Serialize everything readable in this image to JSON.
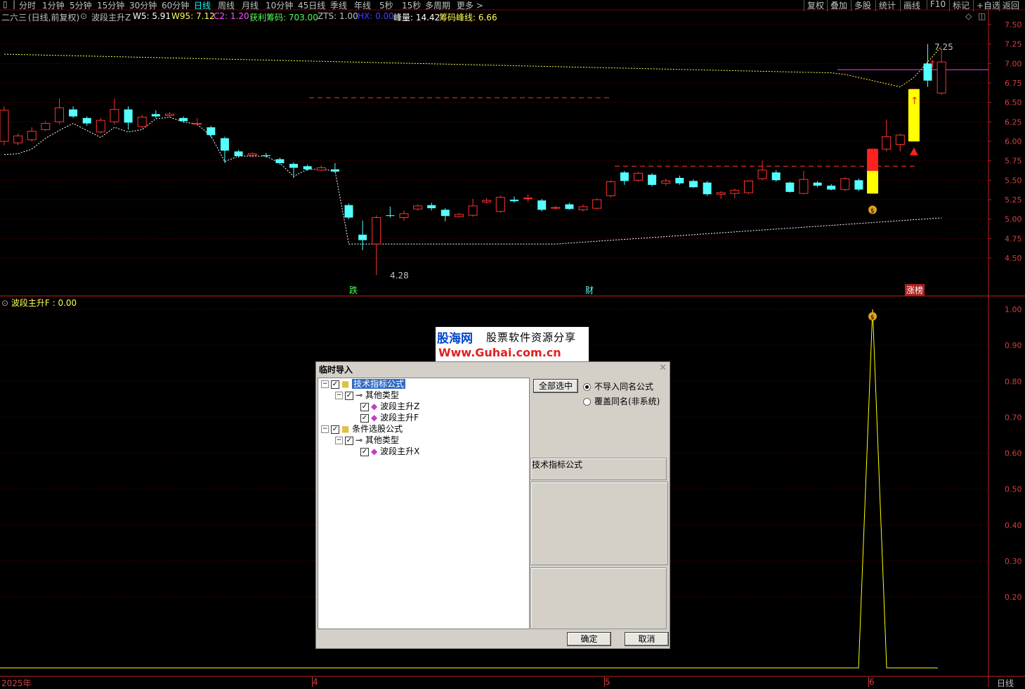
{
  "toolbar": {
    "tabs": [
      "分时",
      "1分钟",
      "5分钟",
      "15分钟",
      "30分钟",
      "60分钟",
      "日线",
      "周线",
      "月线",
      "10分钟",
      "45日线",
      "季线",
      "年线",
      "5秒",
      "15秒",
      "多周期",
      "更多 >"
    ],
    "active_tab": "日线",
    "right_buttons": [
      "复权",
      "叠加",
      "多股",
      "统计",
      "画线",
      "F10",
      "标记",
      "+自选",
      "返回"
    ]
  },
  "info": {
    "stock": "二六三",
    "period": "(日线,前复权)",
    "indicator": "波段主升Z",
    "w5": "W5: 5.91",
    "w95": "W95: 7.12",
    "c2": "C2: 1.20",
    "profit_chips": "获利筹码: 703.00",
    "zts": "ZTS: 1.00",
    "hx": "HX: 0.00",
    "peak": "峰量: 14.42",
    "chip_peak": "筹码峰线: 6.66"
  },
  "colors": {
    "up": "#ff3232",
    "down": "#54ffff",
    "grid": "#800000",
    "axis": "#d04040"
  },
  "price_axis": [
    "7.50",
    "7.25",
    "7.00",
    "6.75",
    "6.50",
    "6.25",
    "6.00",
    "5.75",
    "5.50",
    "5.25",
    "5.00",
    "4.75",
    "4.50"
  ],
  "annotations": {
    "low": "4.28",
    "high": "7.25",
    "tag_die": "跌",
    "tag_cai": "财",
    "tag_zt": "涨榜"
  },
  "sub": {
    "title": "波段主升F : 0.00",
    "axis": [
      "1.00",
      "0.90",
      "0.80",
      "0.70",
      "0.60",
      "0.50",
      "0.40",
      "0.30",
      "0.20"
    ]
  },
  "bottom": {
    "dates": [
      "2025年",
      "4",
      "5",
      "6"
    ],
    "period_label": "日线"
  },
  "banner": {
    "line1": "股海网",
    "line1b": "股票软件资源分享",
    "line2": "Www.Guhai.com.cn"
  },
  "dialog": {
    "title": "临时导入",
    "close": "✕",
    "tree": {
      "root1": "技术指标公式",
      "cat1": "其他类型",
      "item1": "波段主升Z",
      "item2": "波段主升F",
      "root2": "条件选股公式",
      "cat2": "其他类型",
      "item3": "波段主升X"
    },
    "select_all": "全部选中",
    "opt1": "不导入同名公式",
    "opt2": "覆盖同名(非系统)",
    "info_label": "技术指标公式",
    "ok": "确定",
    "cancel": "取消"
  },
  "chart_data": {
    "type": "candlestick",
    "candles": [
      {
        "o": 6.0,
        "c": 6.4,
        "h": 6.45,
        "l": 5.95
      },
      {
        "o": 5.98,
        "c": 6.07,
        "h": 6.1,
        "l": 5.95
      },
      {
        "o": 6.02,
        "c": 6.13,
        "h": 6.18,
        "l": 6.0
      },
      {
        "o": 6.15,
        "c": 6.23,
        "h": 6.26,
        "l": 6.13
      },
      {
        "o": 6.25,
        "c": 6.43,
        "h": 6.55,
        "l": 6.22
      },
      {
        "o": 6.41,
        "c": 6.32,
        "h": 6.45,
        "l": 6.3
      },
      {
        "o": 6.3,
        "c": 6.23,
        "h": 6.32,
        "l": 6.2
      },
      {
        "o": 6.12,
        "c": 6.27,
        "h": 6.3,
        "l": 6.1
      },
      {
        "o": 6.25,
        "c": 6.41,
        "h": 6.55,
        "l": 6.22
      },
      {
        "o": 6.41,
        "c": 6.24,
        "h": 6.45,
        "l": 6.15
      },
      {
        "o": 6.19,
        "c": 6.31,
        "h": 6.34,
        "l": 6.17
      },
      {
        "o": 6.35,
        "c": 6.32,
        "h": 6.4,
        "l": 6.3
      },
      {
        "o": 6.33,
        "c": 6.35,
        "h": 6.38,
        "l": 6.31
      },
      {
        "o": 6.3,
        "c": 6.26,
        "h": 6.32,
        "l": 6.24
      },
      {
        "o": 6.22,
        "c": 6.23,
        "h": 6.3,
        "l": 6.2
      },
      {
        "o": 6.18,
        "c": 6.08,
        "h": 6.2,
        "l": 6.05
      },
      {
        "o": 6.04,
        "c": 5.88,
        "h": 6.06,
        "l": 5.72
      },
      {
        "o": 5.87,
        "c": 5.81,
        "h": 5.89,
        "l": 5.79
      },
      {
        "o": 5.82,
        "c": 5.84,
        "h": 5.86,
        "l": 5.79
      },
      {
        "o": 5.82,
        "c": 5.81,
        "h": 5.85,
        "l": 5.79
      },
      {
        "o": 5.77,
        "c": 5.72,
        "h": 5.79,
        "l": 5.7
      },
      {
        "o": 5.71,
        "c": 5.66,
        "h": 5.73,
        "l": 5.53
      },
      {
        "o": 5.68,
        "c": 5.64,
        "h": 5.7,
        "l": 5.62
      },
      {
        "o": 5.63,
        "c": 5.66,
        "h": 5.69,
        "l": 5.62
      },
      {
        "o": 5.64,
        "c": 5.61,
        "h": 5.72,
        "l": 5.6
      },
      {
        "o": 5.18,
        "c": 5.02,
        "h": 5.2,
        "l": 5.0
      },
      {
        "o": 4.8,
        "c": 4.73,
        "h": 4.98,
        "l": 4.6
      },
      {
        "o": 4.68,
        "c": 5.02,
        "h": 5.05,
        "l": 4.28
      },
      {
        "o": 5.05,
        "c": 5.04,
        "h": 5.16,
        "l": 5.02
      },
      {
        "o": 5.02,
        "c": 5.07,
        "h": 5.11,
        "l": 4.98
      },
      {
        "o": 5.13,
        "c": 5.17,
        "h": 5.19,
        "l": 5.11
      },
      {
        "o": 5.18,
        "c": 5.14,
        "h": 5.21,
        "l": 5.11
      },
      {
        "o": 5.12,
        "c": 5.04,
        "h": 5.14,
        "l": 4.97
      },
      {
        "o": 5.03,
        "c": 5.06,
        "h": 5.08,
        "l": 5.02
      },
      {
        "o": 5.05,
        "c": 5.17,
        "h": 5.26,
        "l": 5.03
      },
      {
        "o": 5.22,
        "c": 5.24,
        "h": 5.27,
        "l": 5.2
      },
      {
        "o": 5.1,
        "c": 5.28,
        "h": 5.3,
        "l": 5.08
      },
      {
        "o": 5.25,
        "c": 5.23,
        "h": 5.29,
        "l": 5.21
      },
      {
        "o": 5.27,
        "c": 5.27,
        "h": 5.32,
        "l": 5.22
      },
      {
        "o": 5.24,
        "c": 5.12,
        "h": 5.26,
        "l": 5.1
      },
      {
        "o": 5.14,
        "c": 5.15,
        "h": 5.17,
        "l": 5.12
      },
      {
        "o": 5.19,
        "c": 5.13,
        "h": 5.21,
        "l": 5.12
      },
      {
        "o": 5.12,
        "c": 5.16,
        "h": 5.19,
        "l": 5.1
      },
      {
        "o": 5.14,
        "c": 5.25,
        "h": 5.27,
        "l": 5.12
      },
      {
        "o": 5.3,
        "c": 5.48,
        "h": 5.5,
        "l": 5.28
      },
      {
        "o": 5.6,
        "c": 5.49,
        "h": 5.62,
        "l": 5.44
      },
      {
        "o": 5.5,
        "c": 5.59,
        "h": 5.61,
        "l": 5.48
      },
      {
        "o": 5.57,
        "c": 5.44,
        "h": 5.59,
        "l": 5.42
      },
      {
        "o": 5.46,
        "c": 5.49,
        "h": 5.52,
        "l": 5.43
      },
      {
        "o": 5.53,
        "c": 5.46,
        "h": 5.56,
        "l": 5.44
      },
      {
        "o": 5.49,
        "c": 5.41,
        "h": 5.51,
        "l": 5.4
      },
      {
        "o": 5.47,
        "c": 5.32,
        "h": 5.49,
        "l": 5.3
      },
      {
        "o": 5.32,
        "c": 5.34,
        "h": 5.36,
        "l": 5.26
      },
      {
        "o": 5.33,
        "c": 5.37,
        "h": 5.39,
        "l": 5.27
      },
      {
        "o": 5.34,
        "c": 5.49,
        "h": 5.5,
        "l": 5.32
      },
      {
        "o": 5.52,
        "c": 5.63,
        "h": 5.75,
        "l": 5.5
      },
      {
        "o": 5.6,
        "c": 5.5,
        "h": 5.63,
        "l": 5.48
      },
      {
        "o": 5.47,
        "c": 5.35,
        "h": 5.48,
        "l": 5.34
      },
      {
        "o": 5.33,
        "c": 5.51,
        "h": 5.62,
        "l": 5.32
      },
      {
        "o": 5.47,
        "c": 5.43,
        "h": 5.49,
        "l": 5.41
      },
      {
        "o": 5.43,
        "c": 5.38,
        "h": 5.45,
        "l": 5.37
      },
      {
        "o": 5.38,
        "c": 5.52,
        "h": 5.54,
        "l": 5.36
      },
      {
        "o": 5.5,
        "c": 5.38,
        "h": 5.52,
        "l": 5.36
      },
      {
        "o": 5.33,
        "c": 5.9,
        "h": 5.9,
        "l": 5.33
      },
      {
        "o": 5.9,
        "c": 6.06,
        "h": 6.28,
        "l": 5.87
      },
      {
        "o": 5.96,
        "c": 6.08,
        "h": 6.1,
        "l": 5.87
      },
      {
        "o": 6.0,
        "c": 6.67,
        "h": 6.67,
        "l": 6.0
      },
      {
        "o": 7.0,
        "c": 6.78,
        "h": 7.25,
        "l": 6.7
      },
      {
        "o": 6.62,
        "c": 7.02,
        "h": 7.18,
        "l": 6.6
      }
    ],
    "marker_values": [
      0,
      0,
      0,
      0,
      0,
      0,
      0,
      0,
      0,
      0,
      0,
      0,
      0,
      0,
      0,
      0,
      0,
      0,
      0,
      0,
      0,
      0,
      0,
      0,
      0,
      0,
      0,
      0,
      0,
      0,
      0,
      0,
      0,
      0,
      0,
      0,
      0,
      0,
      0,
      0,
      0,
      0,
      0,
      0,
      0,
      0,
      0,
      0,
      0,
      0,
      0,
      0,
      0,
      0,
      0,
      0,
      0,
      0,
      0,
      0,
      0,
      0,
      0,
      1,
      0,
      0,
      0,
      0
    ]
  }
}
